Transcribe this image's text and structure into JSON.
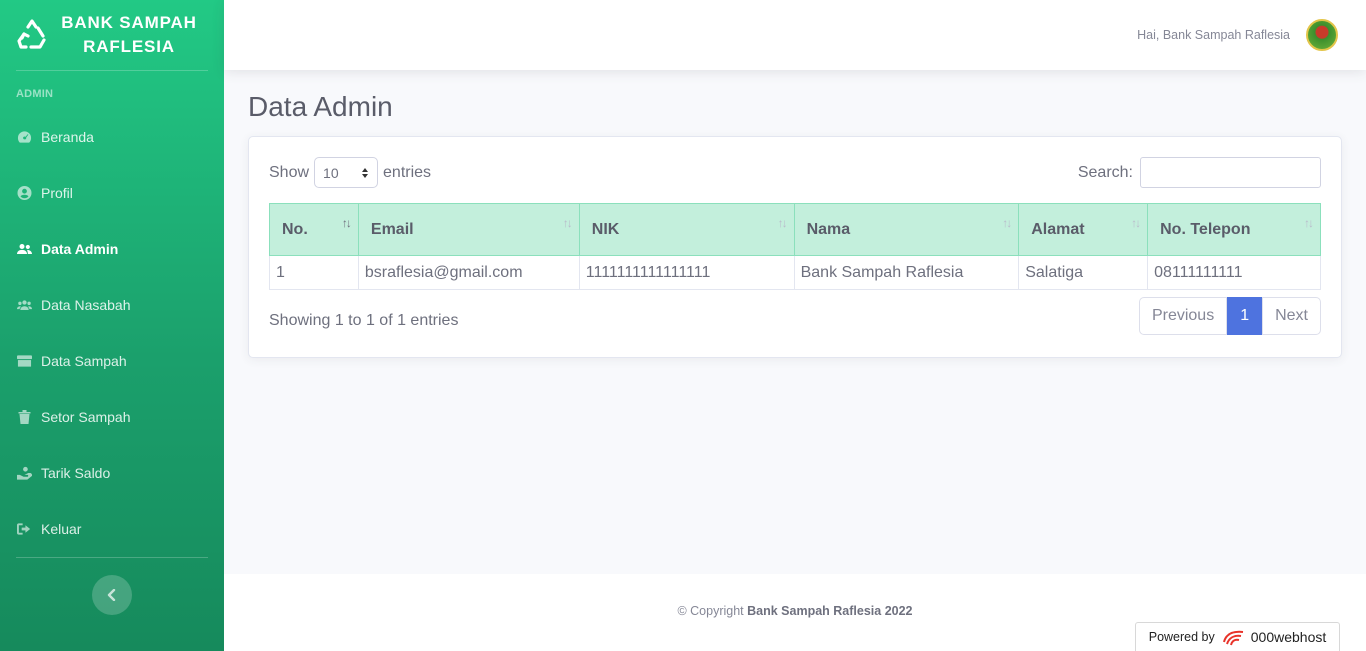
{
  "brand": {
    "line1": "BANK SAMPAH",
    "line2": "RAFLESIA",
    "icon": "recycle-icon"
  },
  "sidebar": {
    "heading": "ADMIN",
    "items": [
      {
        "label": "Beranda",
        "icon": "dashboard-gauge-icon",
        "active": false
      },
      {
        "label": "Profil",
        "icon": "user-circle-icon",
        "active": false
      },
      {
        "label": "Data Admin",
        "icon": "users-icon",
        "active": true
      },
      {
        "label": "Data Nasabah",
        "icon": "users-group-icon",
        "active": false
      },
      {
        "label": "Data Sampah",
        "icon": "box-icon",
        "active": false
      },
      {
        "label": "Setor Sampah",
        "icon": "trash-icon",
        "active": false
      },
      {
        "label": "Tarik Saldo",
        "icon": "hand-holding-icon",
        "active": false
      },
      {
        "label": "Keluar",
        "icon": "sign-out-icon",
        "active": false
      }
    ]
  },
  "topbar": {
    "greeting": "Hai, Bank Sampah Raflesia"
  },
  "page": {
    "title": "Data Admin"
  },
  "table_controls": {
    "show_label": "Show",
    "entries_value": "10",
    "entries_label": "entries",
    "search_label": "Search:",
    "search_value": ""
  },
  "table": {
    "columns": [
      "No.",
      "Email",
      "NIK",
      "Nama",
      "Alamat",
      "No. Telepon"
    ],
    "rows": [
      [
        "1",
        "bsraflesia@gmail.com",
        "1111111111111111",
        "Bank Sampah Raflesia",
        "Salatiga",
        "08111111111"
      ]
    ]
  },
  "info": "Showing 1 to 1 of 1 entries",
  "pagination": {
    "previous": "Previous",
    "current": "1",
    "next": "Next"
  },
  "footer": {
    "prefix": "© Copyright",
    "name": "Bank Sampah Raflesia 2022"
  },
  "powered": {
    "label": "Powered by",
    "host": "000webhost"
  },
  "colors": {
    "sidebar_top": "#22c985",
    "sidebar_bottom": "#168a5c",
    "header_bg": "#c3efdc",
    "accent": "#4e73df"
  }
}
